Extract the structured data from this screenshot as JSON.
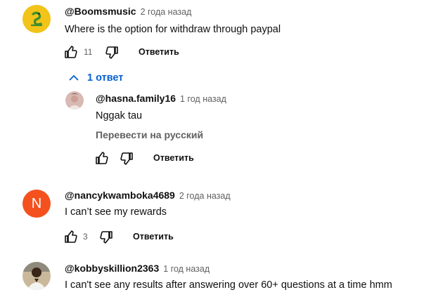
{
  "comments": [
    {
      "author": "@Boomsmusic",
      "date": "2 года назад",
      "text": "Where is the option for withdraw through paypal",
      "likes": "11",
      "reply_label": "Ответить",
      "replies_toggle": "1 ответ",
      "avatar_bg": "#f2c318"
    },
    {
      "author": "@nancykwamboka4689",
      "date": "2 года назад",
      "text": "I can’t see my rewards",
      "likes": "3",
      "reply_label": "Ответить",
      "avatar_letter": "N",
      "avatar_bg": "#f4511e"
    },
    {
      "author": "@kobbyskillion2363",
      "date": "1 год назад",
      "text": "I can't see any results after answering over 60+ questions at a time hmm"
    }
  ],
  "reply": {
    "author": "@hasna.family16",
    "date": "1 год назад",
    "text": "Nggak tau",
    "translate": "Перевести на русский",
    "reply_label": "Ответить"
  },
  "colors": {
    "link_blue": "#065fd4",
    "secondary_text": "#606060"
  }
}
